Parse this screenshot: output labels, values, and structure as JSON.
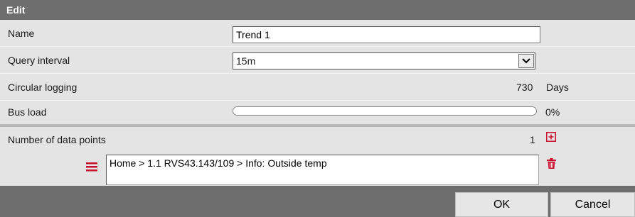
{
  "dialog": {
    "title": "Edit"
  },
  "fields": {
    "name": {
      "label": "Name",
      "value": "Trend 1"
    },
    "query_interval": {
      "label": "Query interval",
      "value": "15m"
    },
    "circular_logging": {
      "label": "Circular logging",
      "value": "730",
      "unit": "Days"
    },
    "bus_load": {
      "label": "Bus load",
      "value": "0%",
      "fraction": 0
    }
  },
  "data_points": {
    "label": "Number of data points",
    "count": "1",
    "items": [
      {
        "path": "Home > 1.1 RVS43.143/109 > Info: Outside temp"
      }
    ]
  },
  "footer": {
    "ok_label": "OK",
    "cancel_label": "Cancel"
  },
  "colors": {
    "title_bar": "#6e6e6e",
    "accent_red": "#c8102e",
    "background": "#e4e4e4"
  },
  "icons": [
    "chevron-down-icon",
    "add-box-icon",
    "drag-handle-icon",
    "trash-icon"
  ]
}
